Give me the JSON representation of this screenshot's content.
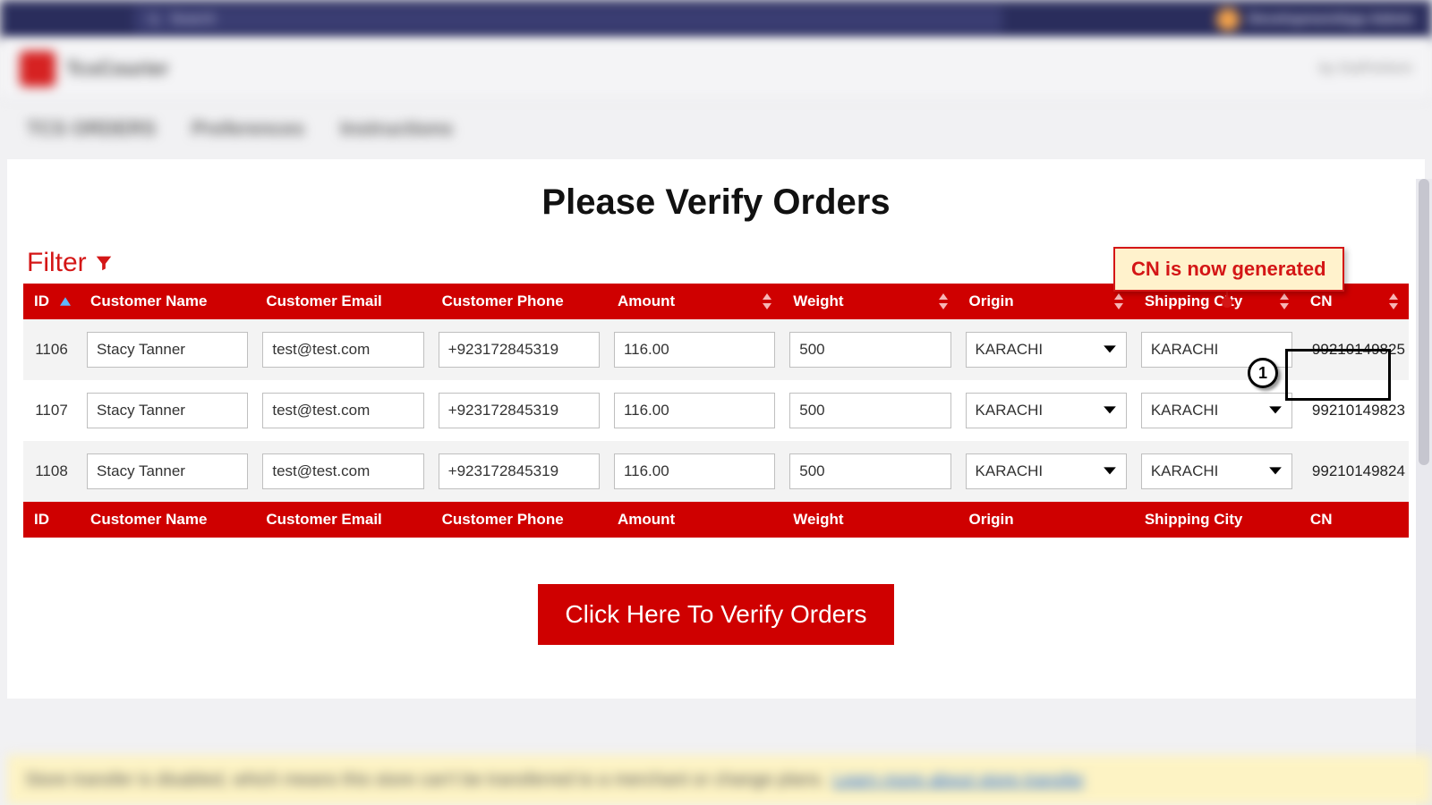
{
  "topbar": {
    "search_placeholder": "Search",
    "user_label": "DevelopmentApp Admin"
  },
  "appheader": {
    "app_name": "TcsCourier",
    "by_label": "by OutPerform"
  },
  "tabs": {
    "t0": "TCS ORDERS",
    "t1": "Preferences",
    "t2": "Instructions"
  },
  "page": {
    "title": "Please Verify Orders",
    "filter_label": "Filter"
  },
  "columns": {
    "id": "ID",
    "name": "Customer Name",
    "email": "Customer Email",
    "phone": "Customer Phone",
    "amount": "Amount",
    "weight": "Weight",
    "origin": "Origin",
    "ship": "Shipping City",
    "cn": "CN"
  },
  "rows": [
    {
      "id": "1106",
      "name": "Stacy Tanner",
      "email": "test@test.com",
      "phone": "+923172845319",
      "amount": "116.00",
      "weight": "500",
      "origin": "KARACHI",
      "ship": "KARACHI",
      "cn": "99210149825",
      "ship_as_select": false
    },
    {
      "id": "1107",
      "name": "Stacy Tanner",
      "email": "test@test.com",
      "phone": "+923172845319",
      "amount": "116.00",
      "weight": "500",
      "origin": "KARACHI",
      "ship": "KARACHI",
      "cn": "99210149823",
      "ship_as_select": true
    },
    {
      "id": "1108",
      "name": "Stacy Tanner",
      "email": "test@test.com",
      "phone": "+923172845319",
      "amount": "116.00",
      "weight": "500",
      "origin": "KARACHI",
      "ship": "KARACHI",
      "cn": "99210149824",
      "ship_as_select": true
    }
  ],
  "verify_button": "Click Here To Verify Orders",
  "annotation": {
    "callout": "CN is now generated",
    "marker": "1"
  },
  "bottom_banner": {
    "text": "Store transfer is disabled, which means this store can't be transferred to a merchant or change plans.",
    "link": "Learn more about store transfer"
  }
}
